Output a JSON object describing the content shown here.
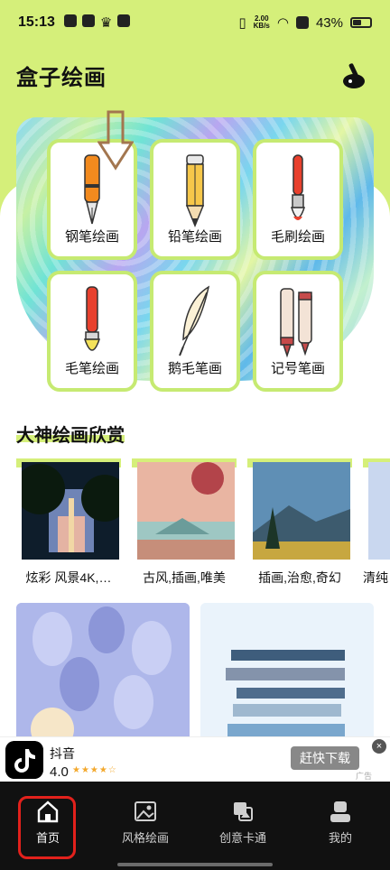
{
  "status_bar": {
    "time": "15:13",
    "net_speed_value": "2.00",
    "net_speed_unit": "KB/s",
    "battery": "43%"
  },
  "header": {
    "title": "盒子绘画"
  },
  "tools": [
    {
      "label": "钢笔绘画",
      "icon": "fountain-pen-icon"
    },
    {
      "label": "铅笔绘画",
      "icon": "pencil-icon"
    },
    {
      "label": "毛刷绘画",
      "icon": "brush-icon"
    },
    {
      "label": "毛笔绘画",
      "icon": "calligraphy-brush-icon"
    },
    {
      "label": "鹅毛笔画",
      "icon": "quill-icon"
    },
    {
      "label": "记号笔画",
      "icon": "marker-icon"
    }
  ],
  "gallery": {
    "title": "大神绘画欣赏",
    "items": [
      {
        "caption": "炫彩 风景4K,…"
      },
      {
        "caption": "古风,插画,唯美"
      },
      {
        "caption": "插画,治愈,奇幻"
      },
      {
        "caption": "清纯"
      }
    ]
  },
  "ad": {
    "app_name": "抖音",
    "rating": "4.0",
    "stars": "★★★★☆",
    "button_label": "赶快下载",
    "close_icon": "×",
    "tag": "广告"
  },
  "nav": {
    "items": [
      {
        "label": "首页",
        "icon": "home-icon"
      },
      {
        "label": "风格绘画",
        "icon": "image-icon"
      },
      {
        "label": "创意卡通",
        "icon": "cartoon-icon"
      },
      {
        "label": "我的",
        "icon": "user-icon"
      }
    ]
  },
  "colors": {
    "accent_green": "#d5ef7a",
    "card_border": "#c6ea72",
    "highlight_red": "#e2211c"
  }
}
